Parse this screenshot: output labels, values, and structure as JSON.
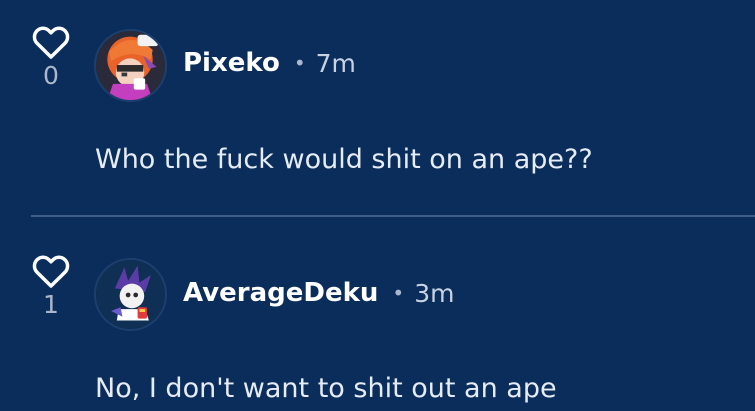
{
  "comments": [
    {
      "likes": "0",
      "username": "Pixeko",
      "separator": "•",
      "time": "7m",
      "text": "Who the fuck would shit on an ape??"
    },
    {
      "likes": "1",
      "username": "AverageDeku",
      "separator": "•",
      "time": "3m",
      "text": "No, I don't want to shit out an ape"
    }
  ],
  "colors": {
    "background": "#0b2d5b",
    "divider": "#3f5d86",
    "heart": "#ffffff"
  },
  "icons": {
    "like": "heart-outline-icon"
  }
}
